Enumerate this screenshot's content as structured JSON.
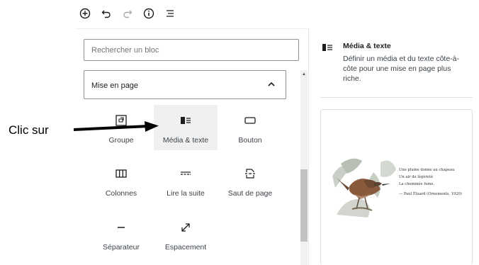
{
  "toolbar": {
    "items": [
      {
        "name": "add-block-icon"
      },
      {
        "name": "undo-icon"
      },
      {
        "name": "redo-icon"
      },
      {
        "name": "info-icon"
      },
      {
        "name": "list-view-icon"
      }
    ]
  },
  "inserter": {
    "search": {
      "placeholder": "Rechercher un bloc"
    },
    "category": {
      "label": "Mise en page",
      "expanded": true
    },
    "blocks": [
      {
        "label": "Groupe",
        "icon": "group-icon"
      },
      {
        "label": "Média & texte",
        "icon": "media-text-icon",
        "selected": true
      },
      {
        "label": "Bouton",
        "icon": "button-icon"
      },
      {
        "label": "Colonnes",
        "icon": "columns-icon"
      },
      {
        "label": "Lire la suite",
        "icon": "more-icon"
      },
      {
        "label": "Saut de page",
        "icon": "page-break-icon"
      },
      {
        "label": "Séparateur",
        "icon": "separator-icon"
      },
      {
        "label": "Espacement",
        "icon": "spacer-icon"
      }
    ]
  },
  "annotation": {
    "text": "Clic sur"
  },
  "preview": {
    "title": "Média & texte",
    "description": "Définir un média et du texte côte-à-côte pour une mise en page plus riche.",
    "poem": {
      "line1": "Une plume donne au chapeau",
      "line2": "Un air de légèreté",
      "line3": "La cheminée fume.",
      "line4": "— Paul Éluard (Ornements, 1920)"
    }
  },
  "colors": {
    "selected_bg": "#f0f0f0",
    "border": "#8c8f94",
    "text": "#1e1e1e",
    "muted": "#757575"
  }
}
